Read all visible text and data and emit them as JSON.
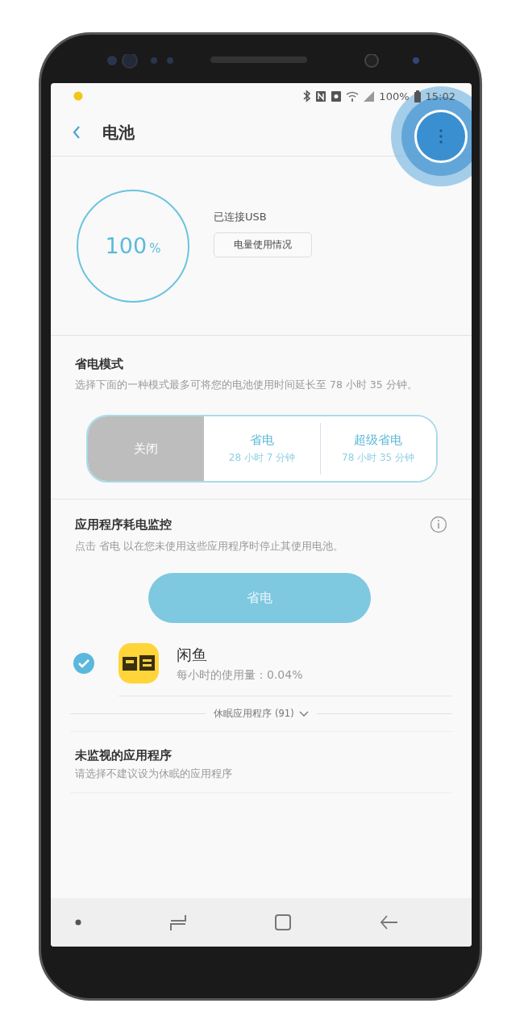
{
  "status_bar": {
    "battery": "100%",
    "time": "15:02"
  },
  "app_bar": {
    "title": "电池",
    "menu_highlighted": true
  },
  "battery": {
    "percent": "100",
    "unit": "%",
    "status": "已连接USB",
    "usage_button": "电量使用情况"
  },
  "power_mode": {
    "title": "省电模式",
    "description": "选择下面的一种模式最多可将您的电池使用时间延长至 78 小时 35 分钟。",
    "options": [
      {
        "label": "关闭",
        "selected": true
      },
      {
        "label": "省电",
        "detail": "28 小时 7 分钟",
        "selected": false
      },
      {
        "label": "超级省电",
        "detail": "78 小时 35 分钟",
        "selected": false
      }
    ]
  },
  "app_monitor": {
    "title": "应用程序耗电监控",
    "description": "点击 省电 以在您未使用这些应用程序时停止其使用电池。",
    "button": "省电",
    "apps": [
      {
        "name": "闲鱼",
        "usage": "每小时的使用量：0.04%",
        "checked": true
      }
    ],
    "sleeping_link": "休眠应用程序 (91)"
  },
  "unmonitored": {
    "title": "未监视的应用程序",
    "description": "请选择不建议设为休眠的应用程序"
  }
}
